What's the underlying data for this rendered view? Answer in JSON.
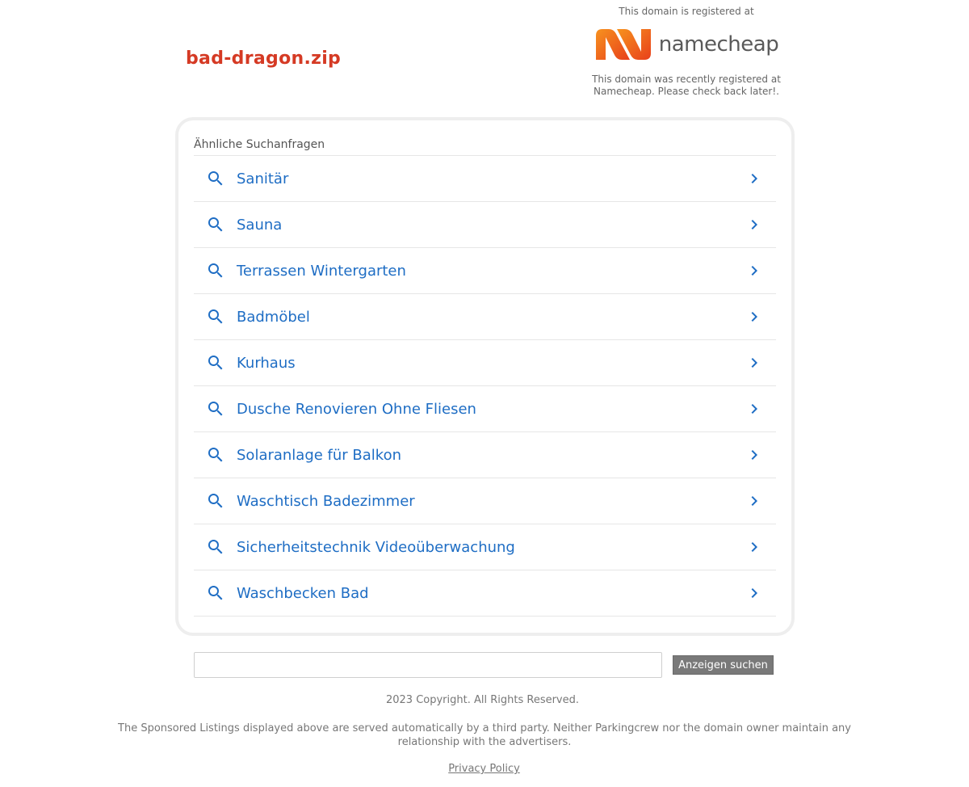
{
  "domain": "bad-dragon.zip",
  "registrar": {
    "registered_label": "This domain is registered at",
    "logo_text": "namecheap",
    "logo_icon": "namecheap-logo-mark",
    "note": "This domain was recently registered at Namecheap. Please check back later!."
  },
  "related": {
    "heading": "Ähnliche Suchanfragen",
    "items": [
      {
        "label": "Sanitär"
      },
      {
        "label": "Sauna"
      },
      {
        "label": "Terrassen Wintergarten"
      },
      {
        "label": "Badmöbel"
      },
      {
        "label": "Kurhaus"
      },
      {
        "label": "Dusche Renovieren Ohne Fliesen"
      },
      {
        "label": "Solaranlage für Balkon"
      },
      {
        "label": "Waschtisch Badezimmer"
      },
      {
        "label": "Sicherheitstechnik Videoüberwachung"
      },
      {
        "label": "Waschbecken Bad"
      }
    ]
  },
  "search": {
    "value": "",
    "button_label": "Anzeigen suchen"
  },
  "footer": {
    "copyright": "2023 Copyright. All Rights Reserved.",
    "disclaimer": "The Sponsored Listings displayed above are served automatically by a third party. Neither Parkingcrew nor the domain owner maintain any relationship with the advertisers.",
    "privacy_label": "Privacy Policy"
  },
  "colors": {
    "domain_title": "#d53a24",
    "link_blue": "#1e6dc4",
    "logo_orange": "#f26522",
    "button_bg": "#797979"
  }
}
